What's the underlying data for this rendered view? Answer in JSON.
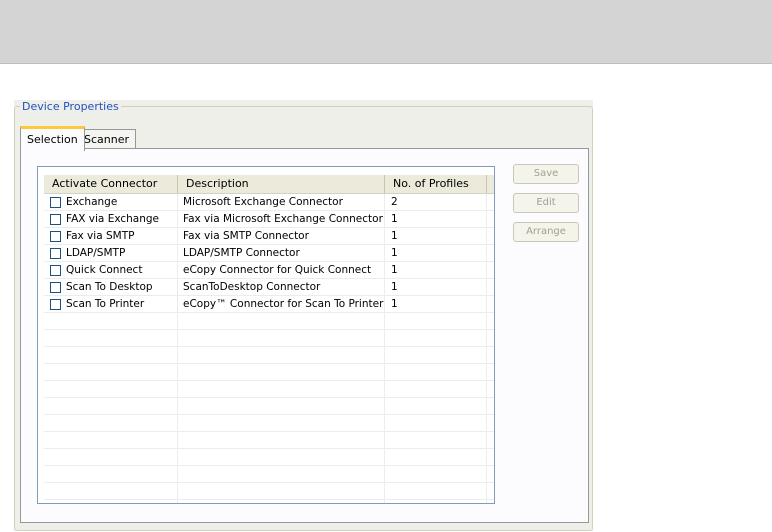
{
  "groupbox": {
    "title": "Device Properties"
  },
  "tabs": [
    {
      "label": "Selection",
      "active": true
    },
    {
      "label": "Scanner",
      "active": false
    }
  ],
  "table": {
    "headers": [
      "Activate Connector",
      "Description",
      "No. of Profiles"
    ],
    "rows": [
      {
        "connector": "Exchange",
        "description": "Microsoft Exchange Connector",
        "profiles": "2",
        "checked": false
      },
      {
        "connector": "FAX via Exchange",
        "description": "Fax via Microsoft Exchange Connector",
        "profiles": "1",
        "checked": false
      },
      {
        "connector": "Fax via SMTP",
        "description": "Fax via SMTP Connector",
        "profiles": "1",
        "checked": false
      },
      {
        "connector": "LDAP/SMTP",
        "description": "LDAP/SMTP Connector",
        "profiles": "1",
        "checked": false
      },
      {
        "connector": "Quick Connect",
        "description": "eCopy Connector for Quick Connect",
        "profiles": "1",
        "checked": false
      },
      {
        "connector": "Scan To Desktop",
        "description": "ScanToDesktop Connector",
        "profiles": "1",
        "checked": false
      },
      {
        "connector": "Scan To Printer",
        "description": "eCopy™ Connector for Scan To Printer",
        "profiles": "1",
        "checked": false
      }
    ]
  },
  "buttons": {
    "save": "Save",
    "edit": "Edit",
    "arrange": "Arrange"
  },
  "colors": {
    "banner": "#d4d4d4",
    "groupbox_title": "#2050c0",
    "tab_highlight": "#ffc83c",
    "disabled_text": "#a1a192"
  }
}
